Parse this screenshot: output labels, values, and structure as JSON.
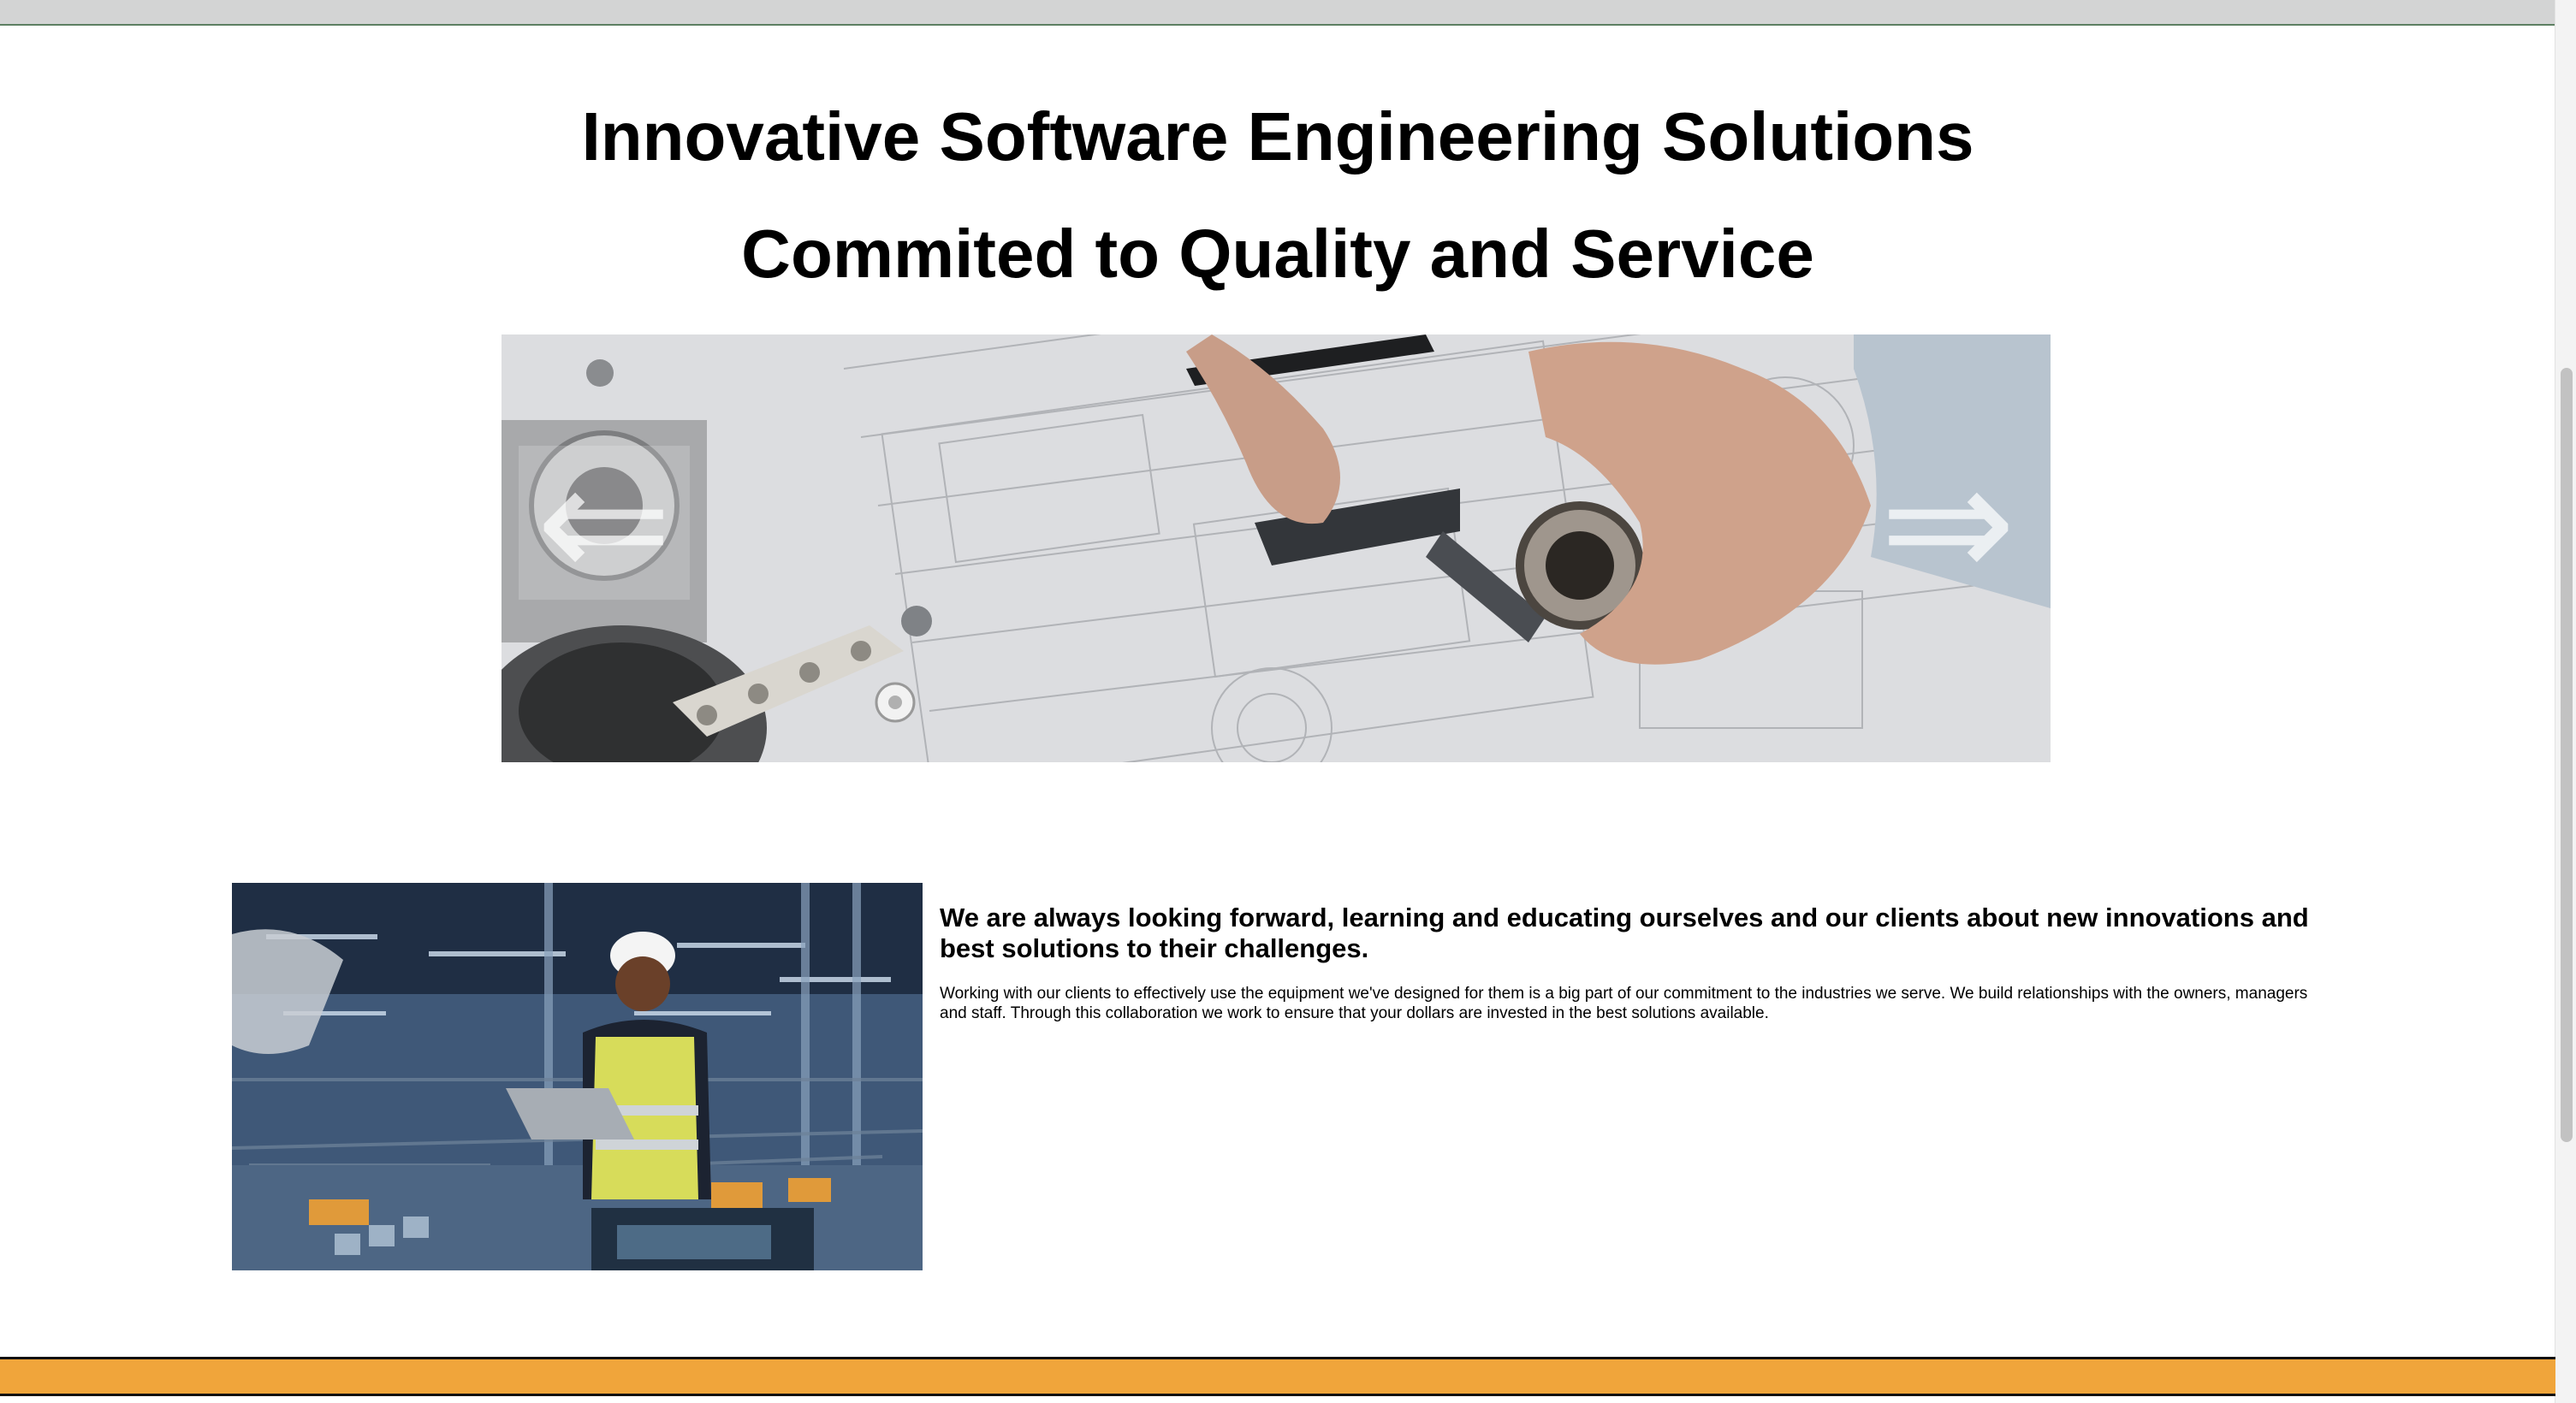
{
  "header": {
    "title": "Innovative Software Engineering Solutions",
    "subtitle": "Commited to Quality and Service"
  },
  "carousel": {
    "prev_arrow": "⇐",
    "next_arrow": "⇒"
  },
  "feature": {
    "heading": "We are always looking forward, learning and educating ourselves and our clients about new innovations and best solutions to their challenges.",
    "body": "Working with our clients to effectively use the equipment we've designed for them is a big part of our commitment to the industries we serve. We build relationships with the owners, managers and staff. Through this collaboration we work to ensure that your dollars are invested in the best solutions available."
  },
  "colors": {
    "footer_accent": "#f0a53b",
    "top_bar": "#d3d4d4",
    "top_bar_border": "#5d7f62"
  }
}
